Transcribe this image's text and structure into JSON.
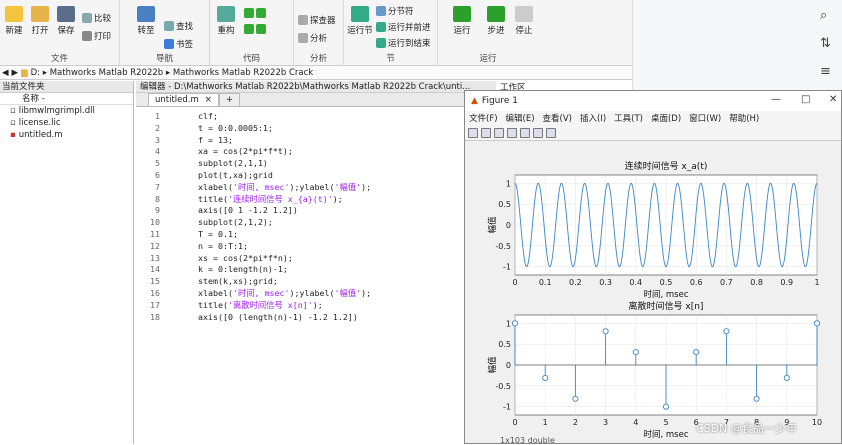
{
  "ribbon": {
    "file_group": "文件",
    "nav_group": "导航",
    "code_group": "代码",
    "analyze_group": "分析",
    "section_group": "节",
    "run_group": "运行",
    "new": "新建",
    "open": "打开",
    "save": "保存",
    "compare": "比较",
    "print": "打印",
    "goto": "转至",
    "find": "查找",
    "bookmark": "书签",
    "refactor": "重构",
    "profiler": "探查器",
    "analyze": "分析",
    "run_section": "运行节",
    "run_and_advance": "运行并前进",
    "run_to_end": "运行到结束",
    "section_break": "分节符",
    "run": "运行",
    "step": "步进",
    "stop": "停止"
  },
  "address": {
    "path": "D: ▸ Mathworks Matlab R2022b ▸ Mathworks Matlab R2022b Crack"
  },
  "folder_panel": {
    "title": "当前文件夹",
    "col_name": "名称 -",
    "files": [
      "libmwlmgrimpl.dll",
      "license.lic",
      "untitled.m"
    ]
  },
  "editor": {
    "title": "编辑器 - D:\\Mathworks Matlab R2022b\\Mathworks Matlab R2022b Crack\\unti...",
    "tab": "untitled.m",
    "workspace_tab": "工作区",
    "lines": [
      {
        "n": "1",
        "t": "clf;"
      },
      {
        "n": "2",
        "t": "t = 0:0.0005:1;"
      },
      {
        "n": "3",
        "t": "f = 13;"
      },
      {
        "n": "4",
        "t": "xa = cos(2*pi*f*t);"
      },
      {
        "n": "5",
        "t": "subplot(2,1,1)"
      },
      {
        "n": "6",
        "t": "plot(t,xa);grid"
      },
      {
        "n": "7",
        "t": "xlabel('时间, msec');ylabel('幅值');"
      },
      {
        "n": "8",
        "t": "title('连续时间信号 x_{a}(t)');"
      },
      {
        "n": "9",
        "t": "axis([0 1 -1.2 1.2])"
      },
      {
        "n": "10",
        "t": "subplot(2,1,2);"
      },
      {
        "n": "11",
        "t": "T = 0.1;"
      },
      {
        "n": "12",
        "t": "n = 0:T:1;"
      },
      {
        "n": "13",
        "t": "xs = cos(2*pi*f*n);"
      },
      {
        "n": "14",
        "t": "k = 0:length(n)-1;"
      },
      {
        "n": "15",
        "t": "stem(k,xs);grid;"
      },
      {
        "n": "16",
        "t": "xlabel('时间, msec');ylabel('幅值');"
      },
      {
        "n": "17",
        "t": "title('离散时间信号 x[n]');"
      },
      {
        "n": "18",
        "t": "axis([0 (length(n)-1) -1.2 1.2])"
      }
    ]
  },
  "figure": {
    "title": "Figure 1",
    "menu": [
      "文件(F)",
      "编辑(E)",
      "查看(V)",
      "插入(I)",
      "工具(T)",
      "桌面(D)",
      "窗口(W)",
      "帮助(H)"
    ]
  },
  "chart_data": [
    {
      "type": "line",
      "title": "连续时间信号 x_a(t)",
      "xlabel": "时间, msec",
      "ylabel": "幅值",
      "xlim": [
        0,
        1
      ],
      "ylim": [
        -1.2,
        1.2
      ],
      "xticks": [
        "0",
        "0.1",
        "0.2",
        "0.3",
        "0.4",
        "0.5",
        "0.6",
        "0.7",
        "0.8",
        "0.9",
        "1"
      ],
      "yticks": [
        "1",
        "0.5",
        "0",
        "-0.5",
        "-1"
      ],
      "function": "cos(2*pi*13*t)",
      "frequency": 13,
      "grid": true,
      "color": "#3a86c8"
    },
    {
      "type": "stem",
      "title": "离散时间信号 x[n]",
      "xlabel": "时间, msec",
      "ylabel": "幅值",
      "xlim": [
        0,
        10
      ],
      "ylim": [
        -1.2,
        1.2
      ],
      "xticks": [
        "0",
        "1",
        "2",
        "3",
        "4",
        "5",
        "6",
        "7",
        "8",
        "9",
        "10"
      ],
      "yticks": [
        "1",
        "0.5",
        "0",
        "-0.5",
        "-1"
      ],
      "x": [
        0,
        1,
        2,
        3,
        4,
        5,
        6,
        7,
        8,
        9,
        10
      ],
      "values": [
        1,
        -0.31,
        -0.81,
        0.81,
        0.31,
        -1,
        0.31,
        0.81,
        -0.81,
        -0.31,
        1
      ],
      "grid": true,
      "color": "#3a86c8"
    }
  ],
  "status": {
    "text": "1x103 double"
  },
  "watermark": "CSDN @食品一少年"
}
